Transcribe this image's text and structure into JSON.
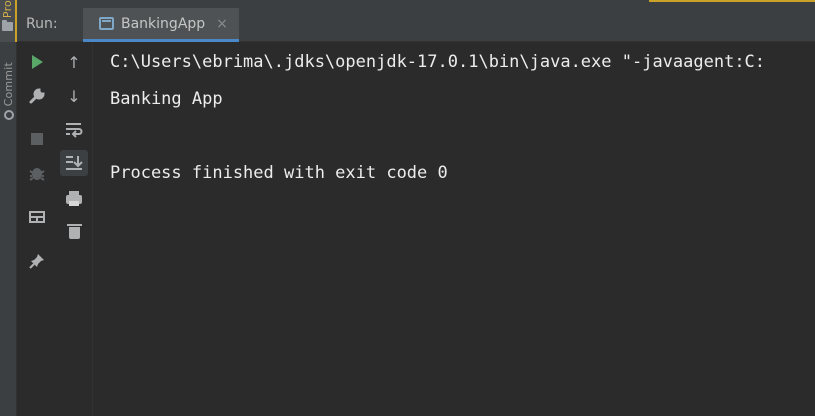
{
  "sidebar": {
    "tabs": [
      {
        "label": "Pro",
        "icon": "folder-icon"
      },
      {
        "label": "Commit",
        "icon": "commit-icon"
      }
    ]
  },
  "header": {
    "run_label": "Run:",
    "tab": {
      "label": "BankingApp",
      "icon": "console-window-icon",
      "close": "×"
    }
  },
  "toolbar_left": [
    {
      "name": "rerun",
      "icon": "play-icon"
    },
    {
      "name": "settings",
      "icon": "wrench-icon"
    },
    {
      "name": "stop",
      "icon": "stop-icon",
      "disabled": true
    },
    {
      "name": "debug",
      "icon": "bug-icon",
      "disabled": true
    },
    {
      "name": "layout",
      "icon": "layout-icon"
    },
    {
      "name": "pin",
      "icon": "pin-icon"
    }
  ],
  "toolbar_right": [
    {
      "name": "up",
      "icon": "arrow-up-icon",
      "glyph": "↑"
    },
    {
      "name": "down",
      "icon": "arrow-down-icon",
      "glyph": "↓"
    },
    {
      "name": "soft-wrap",
      "icon": "soft-wrap-icon"
    },
    {
      "name": "scroll-to-end",
      "icon": "scroll-to-end-icon",
      "active": true
    },
    {
      "name": "print",
      "icon": "printer-icon"
    },
    {
      "name": "clear",
      "icon": "trash-icon"
    }
  ],
  "console": {
    "lines": [
      "C:\\Users\\ebrima\\.jdks\\openjdk-17.0.1\\bin\\java.exe \"-javaagent:C:",
      "Banking App",
      "",
      "Process finished with exit code 0"
    ]
  },
  "colors": {
    "background": "#2b2b2b",
    "panel": "#3c3f41",
    "accent_blue": "#4a88c7",
    "accent_gold": "#c9a227",
    "run_green": "#59a869",
    "text": "#ececec"
  }
}
